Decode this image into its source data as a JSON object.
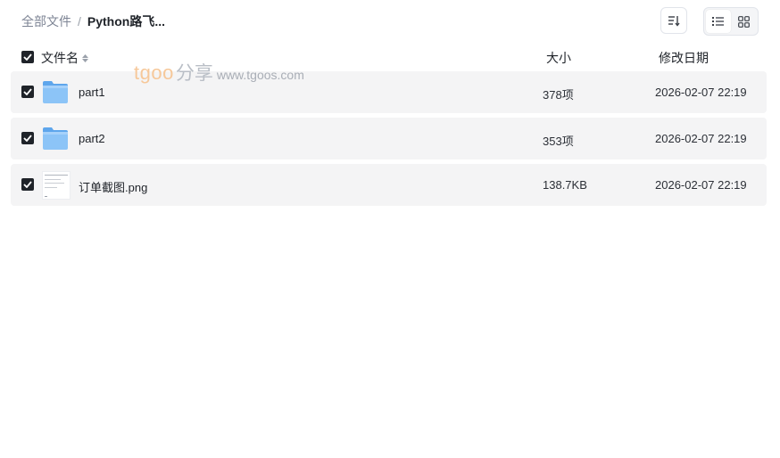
{
  "breadcrumb": {
    "root": "全部文件",
    "separator": "/",
    "current": "Python路飞..."
  },
  "toolbar": {
    "sort_icon": "sort-lines-icon",
    "view_list_icon": "list-view-icon",
    "view_grid_icon": "grid-view-icon",
    "active_view": "list"
  },
  "table": {
    "columns": {
      "name": "文件名",
      "size": "大小",
      "date": "修改日期"
    },
    "rows": [
      {
        "name": "part1",
        "type": "folder",
        "size": "378项",
        "date": "2026-02-07 22:19",
        "checked": true
      },
      {
        "name": "part2",
        "type": "folder",
        "size": "353项",
        "date": "2026-02-07 22:19",
        "checked": true
      },
      {
        "name": "订单截图.png",
        "type": "image",
        "size": "138.7KB",
        "date": "2026-02-07 22:19",
        "checked": true
      }
    ]
  },
  "watermark": {
    "brand": "tgoo",
    "cn": "分享",
    "url": "www.tgoos.com"
  },
  "colors": {
    "row_bg": "#f4f4f5",
    "checkbox": "#1f2329",
    "folder": "#7ab8f5",
    "watermark_brand": "#f6c89a"
  }
}
